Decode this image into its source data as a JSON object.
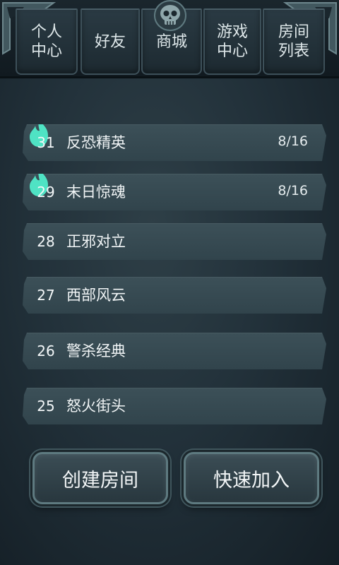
{
  "tabs": [
    {
      "label": "个人\n中心"
    },
    {
      "label": "好友"
    },
    {
      "label": "商城"
    },
    {
      "label": "游戏\n中心"
    },
    {
      "label": "房间\n列表"
    }
  ],
  "rooms": [
    {
      "number": "31",
      "name": "反恐精英",
      "count": "8/16",
      "flame": true
    },
    {
      "number": "29",
      "name": "末日惊魂",
      "count": "8/16",
      "flame": true
    },
    {
      "number": "28",
      "name": "正邪对立",
      "count": "",
      "flame": false
    },
    {
      "number": "27",
      "name": "西部风云",
      "count": "",
      "flame": false
    },
    {
      "number": "26",
      "name": "警杀经典",
      "count": "",
      "flame": false
    },
    {
      "number": "25",
      "name": "怒火街头",
      "count": "",
      "flame": false
    }
  ],
  "buttons": {
    "create_room": "创建房间",
    "quick_join": "快速加入"
  },
  "colors": {
    "flame": "#4fe3c4",
    "row": "#384b53",
    "background": "#22313a"
  },
  "icons": {
    "header_center": "skull-icon",
    "room_status": "flame-icon"
  }
}
